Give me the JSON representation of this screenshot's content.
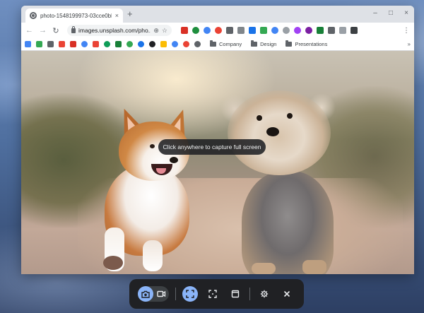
{
  "browser": {
    "tab_title": "photo-1548199973-03cce0bbc8...",
    "tab_close": "×",
    "new_tab": "+",
    "window_controls": [
      "–",
      "□",
      "×"
    ],
    "url": "images.unsplash.com/pho...",
    "bookmark_folders": [
      "Company",
      "Design",
      "Presentations"
    ],
    "bookmarks_more": "»"
  },
  "page": {
    "tooltip": "Click anywhere to capture full screen"
  },
  "capture_bar": {
    "mode_selected": "screenshot",
    "source_selected": "fullscreen",
    "buttons": [
      "screenshot-mode",
      "record-mode",
      "fullscreen-capture",
      "partial-capture",
      "window-capture",
      "settings",
      "close"
    ]
  },
  "colors": {
    "accent": "#8ab4f8",
    "capture_bar_bg": "#202124",
    "tooltip_bg": "#202124"
  }
}
